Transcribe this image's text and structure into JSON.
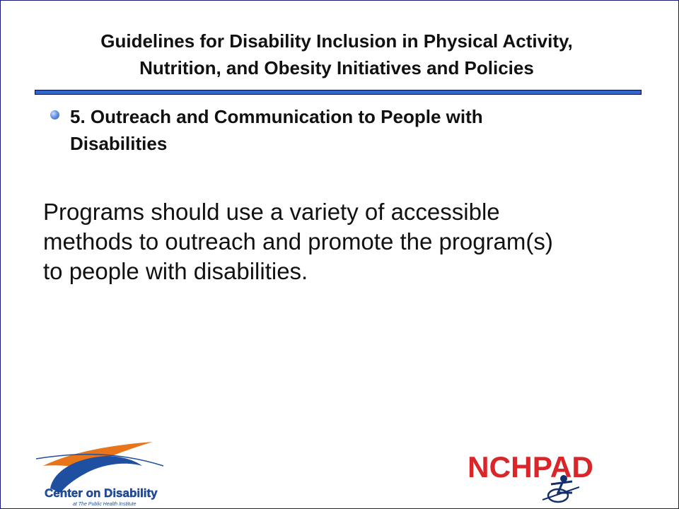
{
  "slide": {
    "title_line1": "Guidelines for Disability Inclusion in Physical Activity,",
    "title_line2": "Nutrition, and Obesity Initiatives and Policies",
    "bullet_line1": "5. Outreach and Communication to People with",
    "bullet_line2": "Disabilities",
    "body_line1": "Programs should use a variety of accessible",
    "body_line2": "methods to outreach and promote the program(s)",
    "body_line3": "to people with disabilities."
  },
  "logos": {
    "left_text": "Center on Disability",
    "left_subtext": "at The Public Health Institute",
    "right_text": "NCHPAD"
  },
  "colors": {
    "rule": "#3366cc",
    "logo_blue": "#1f4fa0",
    "logo_orange": "#e8751a",
    "nchpad_red": "#d9262a",
    "nchpad_navy": "#14306b"
  }
}
